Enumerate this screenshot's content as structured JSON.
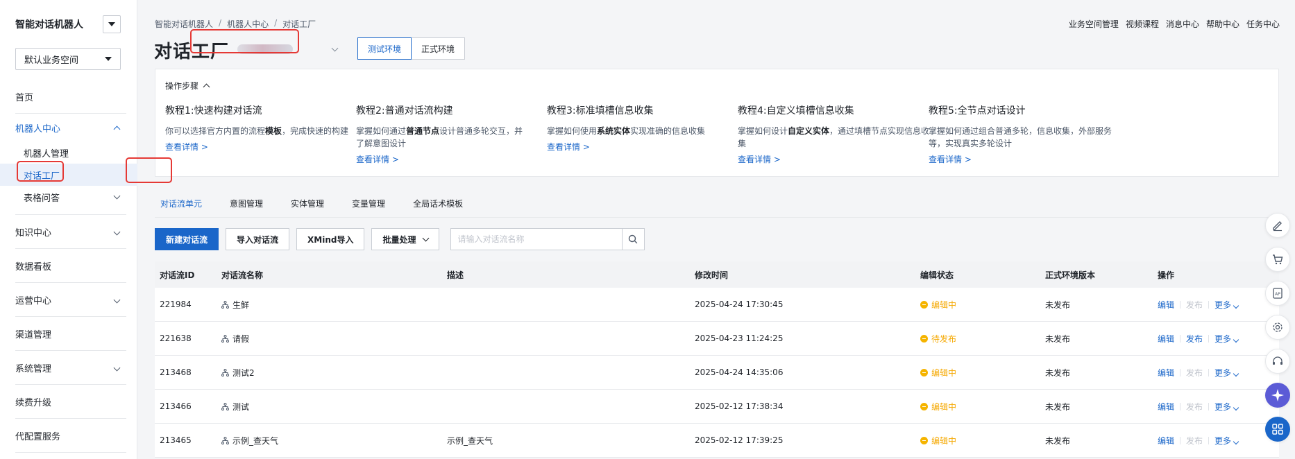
{
  "sidebar": {
    "brand": "智能对话机器人",
    "space_select": "默认业务空间",
    "items": [
      {
        "label": "首页"
      },
      {
        "label": "机器人中心"
      },
      {
        "label": "知识中心"
      },
      {
        "label": "数据看板"
      },
      {
        "label": "运营中心"
      },
      {
        "label": "渠道管理"
      },
      {
        "label": "系统管理"
      },
      {
        "label": "续费升级"
      },
      {
        "label": "代配置服务"
      }
    ],
    "sub_items": [
      {
        "label": "机器人管理"
      },
      {
        "label": "对话工厂"
      },
      {
        "label": "表格问答"
      }
    ]
  },
  "breadcrumb": [
    "智能对话机器人",
    "机器人中心",
    "对话工厂"
  ],
  "top_links": [
    "业务空间管理",
    "视频课程",
    "消息中心",
    "帮助中心",
    "任务中心"
  ],
  "page_title": "对话工厂",
  "env_tabs": [
    "测试环境",
    "正式环境"
  ],
  "steps": {
    "header": "操作步骤",
    "items": [
      {
        "title": "教程1:快速构建对话流",
        "desc_pre": "你可以选择官方内置的流程",
        "desc_bold": "模板",
        "desc_post": "，完成快速的构建",
        "link": "查看详情 >"
      },
      {
        "title": "教程2:普通对话流构建",
        "desc_pre": "掌握如何通过",
        "desc_bold": "普通节点",
        "desc_post": "设计普通多轮交互，并了解意图设计",
        "link": "查看详情 >"
      },
      {
        "title": "教程3:标准填槽信息收集",
        "desc_pre": "掌握如何使用",
        "desc_bold": "系统实体",
        "desc_post": "实现准确的信息收集",
        "link": "查看详情 >"
      },
      {
        "title": "教程4:自定义填槽信息收集",
        "desc_pre": "掌握如何设计",
        "desc_bold": "自定义实体",
        "desc_post": "，通过填槽节点实现信息收集",
        "link": "查看详情 >"
      },
      {
        "title": "教程5:全节点对话设计",
        "desc_pre": "掌握如何通过组合普通多轮，信息收集，外部服务等，实现真实多轮设计",
        "desc_bold": "",
        "desc_post": "",
        "link": "查看详情 >"
      }
    ]
  },
  "tabs": [
    "对话流单元",
    "意图管理",
    "实体管理",
    "变量管理",
    "全局话术模板"
  ],
  "toolbar": {
    "new_label": "新建对话流",
    "import_label": "导入对话流",
    "xmind_label": "XMind导入",
    "batch_label": "批量处理",
    "search_placeholder": "请输入对话流名称"
  },
  "table": {
    "headers": [
      "对话流ID",
      "对话流名称",
      "描述",
      "修改时间",
      "编辑状态",
      "正式环境版本",
      "操作"
    ],
    "rows": [
      {
        "id": "221984",
        "name": "生鲜",
        "desc": "",
        "time": "2025-04-24 17:30:45",
        "status": "编辑中",
        "version": "未发布",
        "publish_enabled": false
      },
      {
        "id": "221638",
        "name": "请假",
        "desc": "",
        "time": "2025-04-23 11:24:25",
        "status": "待发布",
        "version": "未发布",
        "publish_enabled": true
      },
      {
        "id": "213468",
        "name": "测试2",
        "desc": "",
        "time": "2025-04-24 14:35:06",
        "status": "编辑中",
        "version": "未发布",
        "publish_enabled": false
      },
      {
        "id": "213466",
        "name": "测试",
        "desc": "",
        "time": "2025-02-12 17:38:34",
        "status": "编辑中",
        "version": "未发布",
        "publish_enabled": false
      },
      {
        "id": "213465",
        "name": "示例_查天气",
        "desc": "示例_查天气",
        "time": "2025-02-12 17:39:25",
        "status": "编辑中",
        "version": "未发布",
        "publish_enabled": false
      }
    ],
    "ops": {
      "edit": "编辑",
      "publish": "发布",
      "more": "更多"
    }
  },
  "colors": {
    "accent": "#1a66c9",
    "status_warning": "#f5b400",
    "highlight_box": "#e53935",
    "float_purple": "#5b5bd6"
  }
}
